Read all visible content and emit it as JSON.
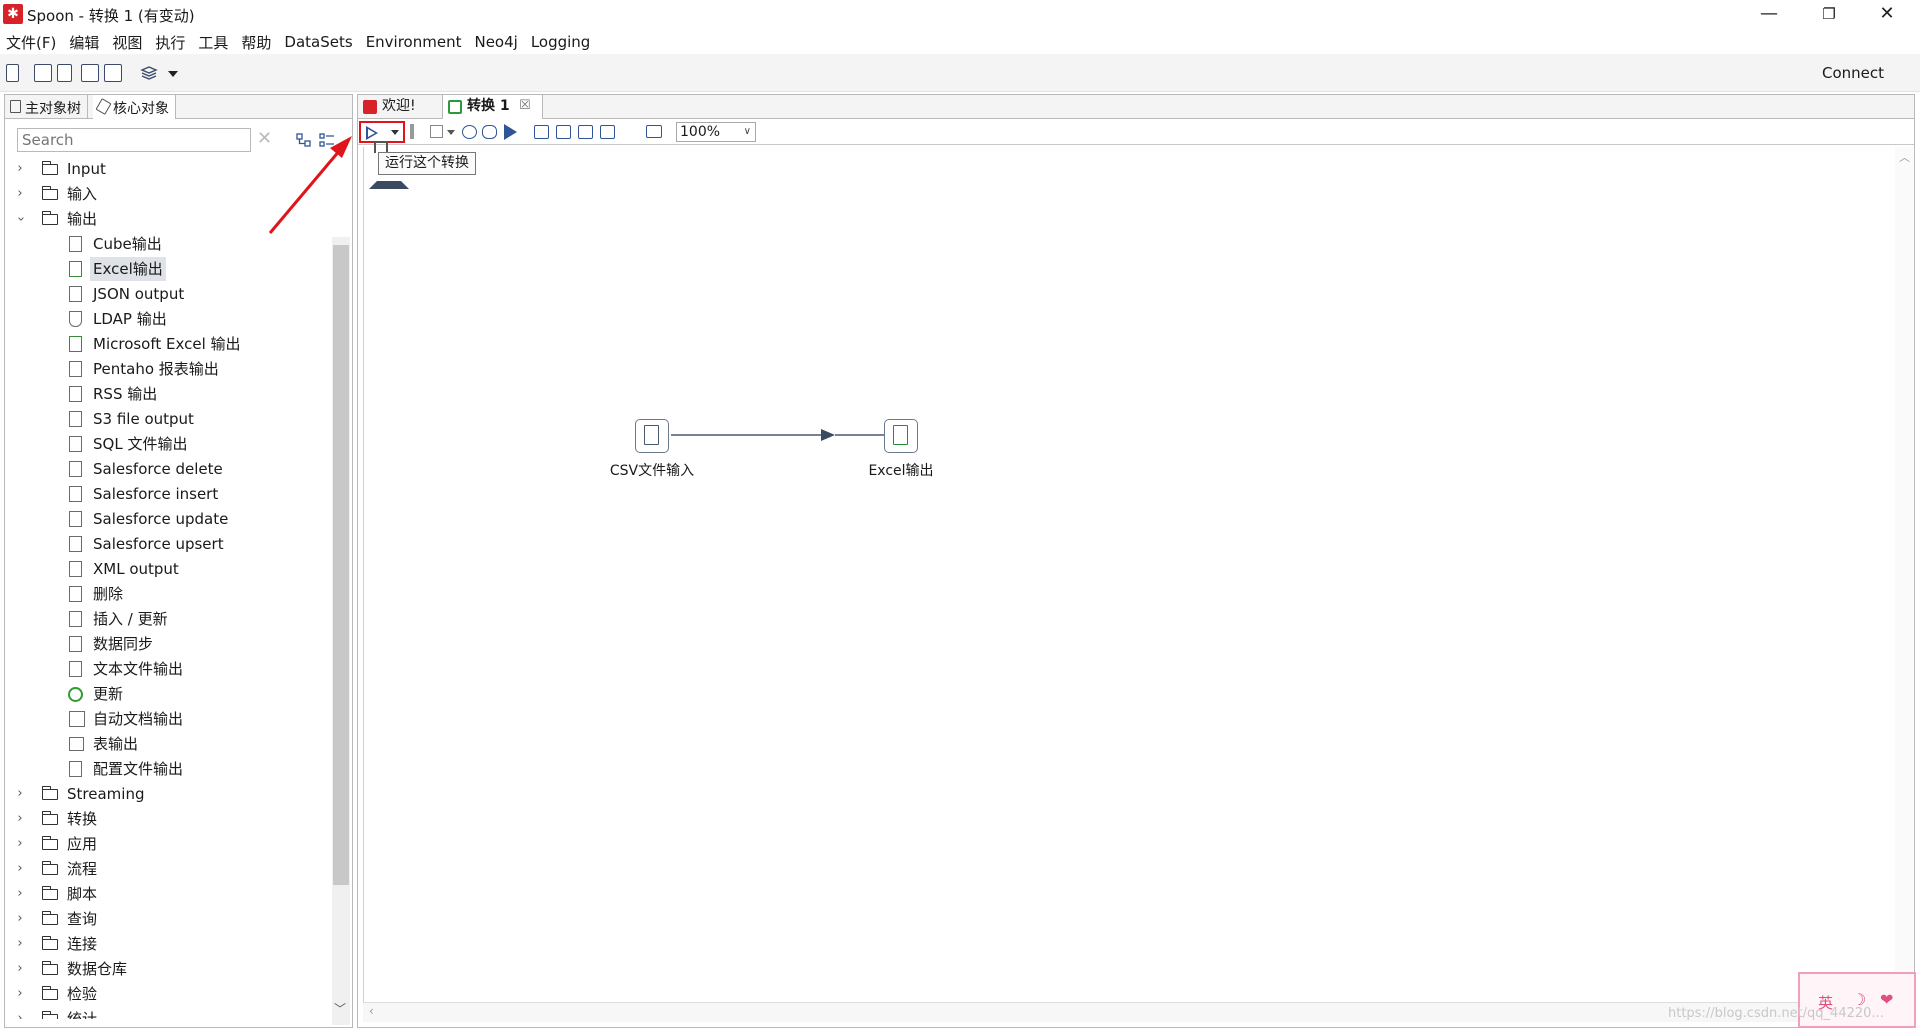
{
  "window": {
    "title": "Spoon - 转换 1 (有变动)",
    "app_icon": "kettle-logo-icon",
    "minimize": "—",
    "restore": "❐",
    "close": "✕"
  },
  "menu": [
    "文件(F)",
    "编辑",
    "视图",
    "执行",
    "工具",
    "帮助",
    "DataSets",
    "Environment",
    "Neo4j",
    "Logging"
  ],
  "toolbar": {
    "connect_label": "Connect"
  },
  "left_panel": {
    "tabs": [
      "主对象树",
      "核心对象"
    ],
    "search_placeholder": "Search",
    "tree_top": [
      {
        "label": "Input",
        "expanded": false
      },
      {
        "label": "输入",
        "expanded": false
      },
      {
        "label": "输出",
        "expanded": true
      }
    ],
    "output_children": [
      "Cube输出",
      "Excel输出",
      "JSON output",
      "LDAP 输出",
      "Microsoft Excel 输出",
      "Pentaho 报表输出",
      "RSS 输出",
      "S3 file output",
      "SQL 文件输出",
      "Salesforce delete",
      "Salesforce insert",
      "Salesforce update",
      "Salesforce upsert",
      "XML output",
      "删除",
      "插入 / 更新",
      "数据同步",
      "文本文件输出",
      "更新",
      "自动文档输出",
      "表输出",
      "配置文件输出"
    ],
    "selected_child": "Excel输出",
    "tree_bottom": [
      "Streaming",
      "转换",
      "应用",
      "流程",
      "脚本",
      "查询",
      "连接",
      "数据仓库",
      "检验",
      "统计"
    ]
  },
  "editor": {
    "tabs": [
      {
        "label": "欢迎!",
        "active": false
      },
      {
        "label": "转换 1",
        "active": true
      }
    ],
    "tab_close": "☒",
    "zoom": "100%",
    "tooltip": "运行这个转换",
    "nodes": [
      {
        "label": "CSV文件输入"
      },
      {
        "label": "Excel输出"
      }
    ]
  },
  "ime": {
    "label": "英"
  },
  "watermark": "https://blog.csdn.net/qq_44220..."
}
